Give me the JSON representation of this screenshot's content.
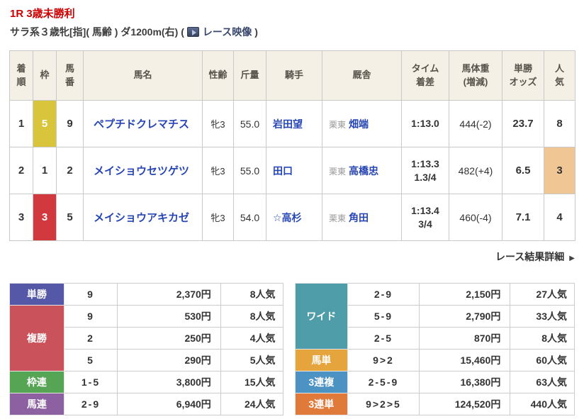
{
  "header": {
    "title": "1R 3歳未勝利",
    "conditions": "サラ系３歳牝[指]( 馬齢 ) ダ1200m(右)",
    "video_open": "(",
    "video_label": "レース映像",
    "video_close": ")"
  },
  "icons": {
    "video_play": "▶",
    "details_arrow": "▶"
  },
  "colors": {
    "title_red": "#cc0000",
    "link_blue": "#2746b4",
    "table_header_beige": "#f4f0e5",
    "frame5_yellow": "#d9c53b",
    "frame3_red": "#d2393f",
    "pop3_highlight": "#f0c694",
    "tansho": "#5558a6",
    "fukusho": "#ca525b",
    "wakuren": "#55a555",
    "umaren": "#8d60a2",
    "wide": "#4f9da8",
    "umatan": "#e6a53c",
    "sanrenpuku": "#4c93c3",
    "sanrentan": "#e07a3b"
  },
  "results_table": {
    "headers": {
      "pos": [
        "着",
        "順"
      ],
      "frame": [
        "枠"
      ],
      "num": [
        "馬",
        "番"
      ],
      "name": [
        "馬名"
      ],
      "sexage": [
        "性齢"
      ],
      "weight": [
        "斤量"
      ],
      "jockey": [
        "騎手"
      ],
      "stable": [
        "厩舎"
      ],
      "time": [
        "タイム",
        "着差"
      ],
      "hweight": [
        "馬体重",
        "(増減)"
      ],
      "odds": [
        "単勝",
        "オッズ"
      ],
      "pop": [
        "人",
        "気"
      ]
    },
    "rows": [
      {
        "pos": "1",
        "frame": "5",
        "num": "9",
        "name": "ペプチドクレマチス",
        "sexage": "牝3",
        "weight": "55.0",
        "jockey": "岩田望",
        "stable_area": "栗東",
        "stable_name": "畑端",
        "time": "1:13.0",
        "margin": "",
        "hweight": "444(-2)",
        "odds": "23.7",
        "pop": "8"
      },
      {
        "pos": "2",
        "frame": "1",
        "num": "2",
        "name": "メイショウセツゲツ",
        "sexage": "牝3",
        "weight": "55.0",
        "jockey": "田口",
        "stable_area": "栗東",
        "stable_name": "高橋忠",
        "time": "1:13.3",
        "margin": "1.3/4",
        "hweight": "482(+4)",
        "odds": "6.5",
        "pop": "3"
      },
      {
        "pos": "3",
        "frame": "3",
        "num": "5",
        "name": "メイショウアキカゼ",
        "sexage": "牝3",
        "weight": "54.0",
        "jockey": "☆高杉",
        "stable_area": "栗東",
        "stable_name": "角田",
        "time": "1:13.4",
        "margin": "3/4",
        "hweight": "460(-4)",
        "odds": "7.1",
        "pop": "4"
      }
    ]
  },
  "details_link": {
    "label": "レース結果詳細"
  },
  "payouts": {
    "left": [
      {
        "key": "tansho",
        "label": "単勝",
        "rows": [
          {
            "combo": "9",
            "pay": "2,370円",
            "pop": "8人気"
          }
        ]
      },
      {
        "key": "fukusho",
        "label": "複勝",
        "rows": [
          {
            "combo": "9",
            "pay": "530円",
            "pop": "8人気"
          },
          {
            "combo": "2",
            "pay": "250円",
            "pop": "4人気"
          },
          {
            "combo": "5",
            "pay": "290円",
            "pop": "5人気"
          }
        ]
      },
      {
        "key": "wakuren",
        "label": "枠連",
        "rows": [
          {
            "combo": "1-5",
            "pay": "3,800円",
            "pop": "15人気"
          }
        ]
      },
      {
        "key": "umaren",
        "label": "馬連",
        "rows": [
          {
            "combo": "2-9",
            "pay": "6,940円",
            "pop": "24人気"
          }
        ]
      }
    ],
    "right": [
      {
        "key": "wide",
        "label": "ワイド",
        "rows": [
          {
            "combo": "2-9",
            "pay": "2,150円",
            "pop": "27人気"
          },
          {
            "combo": "5-9",
            "pay": "2,790円",
            "pop": "33人気"
          },
          {
            "combo": "2-5",
            "pay": "870円",
            "pop": "8人気"
          }
        ]
      },
      {
        "key": "umatan",
        "label": "馬単",
        "rows": [
          {
            "combo": "9>2",
            "pay": "15,460円",
            "pop": "60人気"
          }
        ]
      },
      {
        "key": "sanrenpuku",
        "label": "3連複",
        "rows": [
          {
            "combo": "2-5-9",
            "pay": "16,380円",
            "pop": "63人気"
          }
        ]
      },
      {
        "key": "sanrentan",
        "label": "3連単",
        "rows": [
          {
            "combo": "9>2>5",
            "pay": "124,520円",
            "pop": "440人気"
          }
        ]
      }
    ]
  }
}
